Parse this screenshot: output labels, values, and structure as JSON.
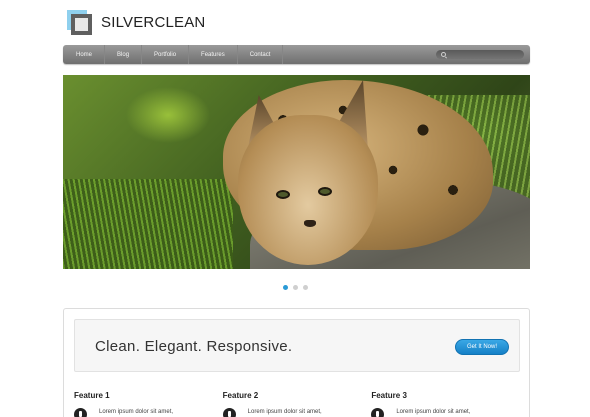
{
  "logo": {
    "text": "SILVERCLEAN"
  },
  "nav": {
    "items": [
      "Home",
      "Blog",
      "Portfolio",
      "Features",
      "Contact"
    ],
    "search_icon": "search-icon"
  },
  "slider": {
    "dots": 3,
    "active_index": 0,
    "accent": "#2a9ad6"
  },
  "banner": {
    "title": "Clean. Elegant. Responsive.",
    "button_label": "Get It Now!"
  },
  "features": [
    {
      "title": "Feature 1",
      "text": "Lorem ipsum dolor sit amet,"
    },
    {
      "title": "Feature 2",
      "text": "Lorem ipsum dolor sit amet,"
    },
    {
      "title": "Feature 3",
      "text": "Lorem ipsum dolor sit amet,"
    }
  ]
}
